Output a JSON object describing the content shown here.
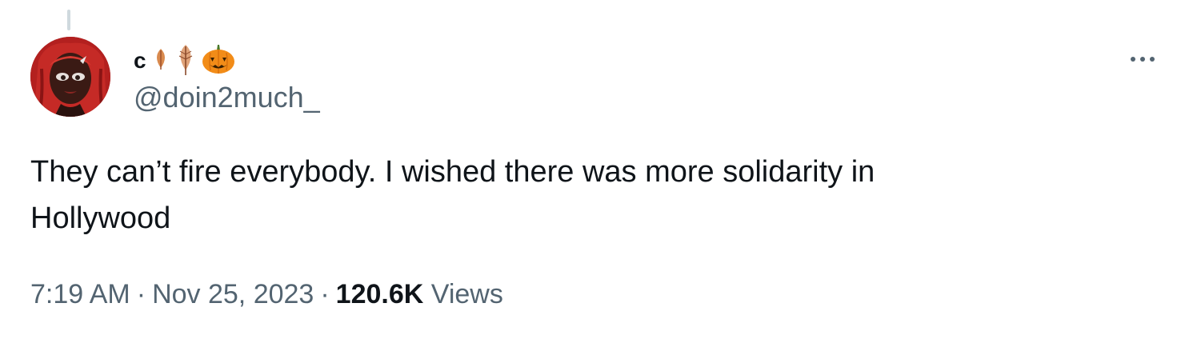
{
  "tweet": {
    "author": {
      "display_name": "c",
      "display_emojis": [
        "fallen-leaf-icon",
        "leaf-icon",
        "jack-o-lantern-icon"
      ],
      "handle": "@doin2much_"
    },
    "text": "They can’t fire everybody. I wished there was more solidarity in\nHollywood",
    "time": "7:19 AM",
    "separator": "·",
    "date": "Nov 25, 2023",
    "views_count": "120.6K",
    "views_label": "Views"
  },
  "colors": {
    "primary_text": "#0f1419",
    "secondary_text": "#536471",
    "divider": "#cfd9de",
    "background": "#ffffff"
  },
  "icons": {
    "more": "more-horizontal-icon",
    "avatar": "avatar"
  }
}
